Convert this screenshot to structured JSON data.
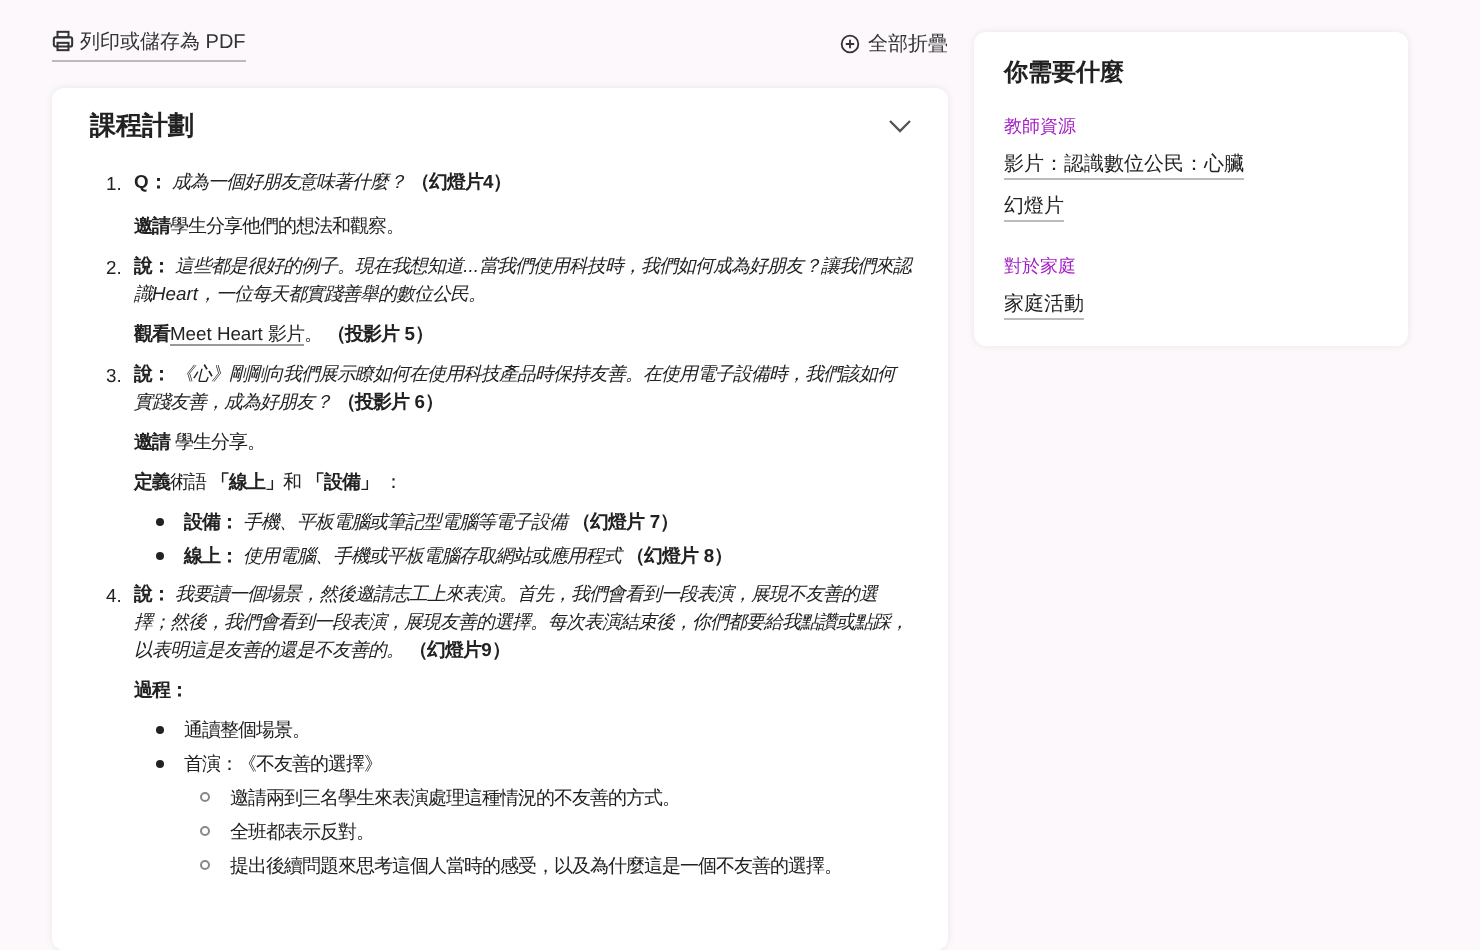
{
  "toolbar": {
    "print_link": "列印或儲存為 PDF",
    "collapse_all": "全部折疊"
  },
  "lesson": {
    "title": "課程計劃",
    "expanded": true,
    "items": [
      {
        "number": "1.",
        "text": "**Q：** *成為一個好朋友意味著什麼？* **（幻燈片4）**",
        "blocks": [
          {
            "kind": "paragraph",
            "parts": [
              {
                "kind": "text",
                "text": "**邀請**學生分享他們的想法和觀察。"
              }
            ]
          }
        ]
      },
      {
        "number": "2.",
        "text": "**說：** *這些都是很好的例子。現在我想知道...當我們使用科技時，我們如何成為好朋友？讓我們來認識Heart，一位每天都實踐善舉的數位公民。*",
        "blocks": [
          {
            "kind": "paragraph",
            "parts": [
              {
                "kind": "text",
                "text": "**觀看**"
              },
              {
                "kind": "link",
                "text": "Meet Heart 影片"
              },
              {
                "kind": "text",
                "text": "。 **（投影片 5）**"
              }
            ]
          }
        ]
      },
      {
        "number": "3.",
        "text": "**說：** *《心》剛剛向我們展示瞭如何在使用科技產品時保持友善。在使用電子設備時，我們該如何實踐友善，成為好朋友？* **（投影片 6）**",
        "blocks": [
          {
            "kind": "paragraph",
            "parts": [
              {
                "kind": "text",
                "text": "**邀請** 學生分享。"
              }
            ]
          },
          {
            "kind": "paragraph",
            "parts": [
              {
                "kind": "text",
                "text": "**定義**術語 **「線上」**和 **「設備」** ："
              }
            ]
          },
          {
            "kind": "bullets",
            "items": [
              {
                "text": "**設備：** *手機、平板電腦或筆記型電腦等電子設備* **（幻燈片 7）**"
              },
              {
                "text": "**線上：** *使用電腦、手機或平板電腦存取網站或應用程式* **（幻燈片 8）**"
              }
            ]
          }
        ]
      },
      {
        "number": "4.",
        "text": "**說：** *我要讀一個場景，然後邀請志工上來表演。首先，我們會看到一段表演，展現不友善的選擇；然後，我們會看到一段表演，展現友善的選擇。每次表演結束後，你們都要給我點讚或點踩，以表明這是友善的還是不友善的。* **（幻燈片9）**",
        "blocks": [
          {
            "kind": "paragraph",
            "parts": [
              {
                "kind": "text",
                "text": "**過程：**"
              }
            ]
          },
          {
            "kind": "bullets",
            "items": [
              {
                "text": "通讀整個場景。"
              },
              {
                "text": "首演：《不友善的選擇》",
                "children": [
                  {
                    "text": "邀請兩到三名學生來表演處理這種情況的不友善的方式。"
                  },
                  {
                    "text": "全班都表示反對。"
                  },
                  {
                    "text": "提出後續問題來思考這個人當時的感受，以及為什麼這是一個不友善的選擇。"
                  }
                ]
              }
            ]
          }
        ]
      }
    ]
  },
  "sidebar": {
    "title": "你需要什麼",
    "sections": [
      {
        "heading": "教師資源",
        "links": [
          "影片：認識數位公民：心臟",
          "幻燈片"
        ]
      },
      {
        "heading": "對於家庭",
        "links": [
          "家庭活動"
        ]
      }
    ]
  }
}
